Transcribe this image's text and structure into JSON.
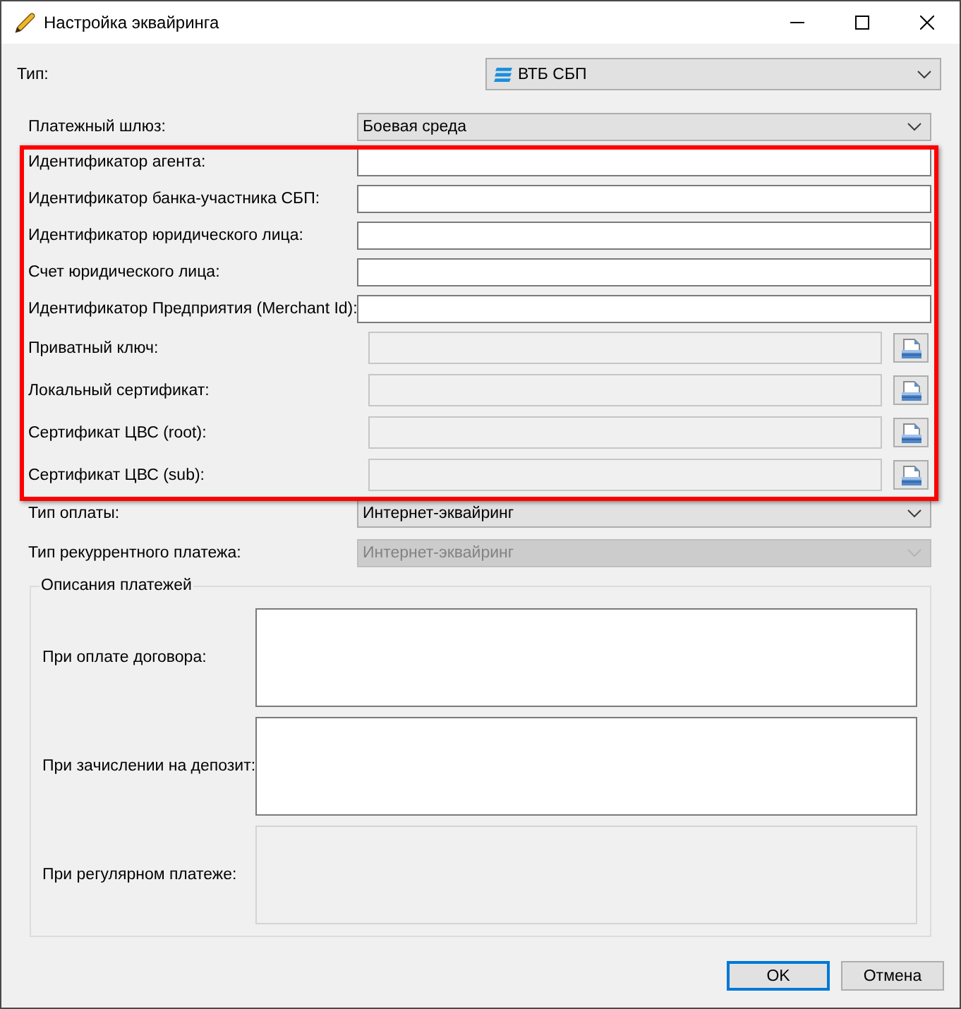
{
  "window": {
    "title": "Настройка эквайринга"
  },
  "type": {
    "label": "Тип:",
    "value": "ВТБ СБП",
    "disabled": false
  },
  "gateway": {
    "label": "Платежный шлюз:",
    "value": "Боевая среда",
    "disabled": false
  },
  "credentials": {
    "highlighted": true,
    "fields": [
      {
        "kind": "text",
        "label": "Идентификатор агента:",
        "disabled": false
      },
      {
        "kind": "text",
        "label": "Идентификатор банка-участника СБП:",
        "disabled": false
      },
      {
        "kind": "text",
        "label": "Идентификатор юридического лица:",
        "disabled": false
      },
      {
        "kind": "text",
        "label": "Счет юридического лица:",
        "disabled": false
      },
      {
        "kind": "text",
        "label": "Идентификатор Предприятия (Merchant Id):",
        "disabled": false
      },
      {
        "kind": "file",
        "label": "Приватный ключ:",
        "disabled": true
      },
      {
        "kind": "file",
        "label": "Локальный сертификат:",
        "disabled": true
      },
      {
        "kind": "file",
        "label": "Сертификат ЦВС (root):",
        "disabled": true
      },
      {
        "kind": "file",
        "label": "Сертификат ЦВС (sub):",
        "disabled": true
      }
    ]
  },
  "payment_type": {
    "label": "Тип оплаты:",
    "value": "Интернет-эквайринг",
    "disabled": false
  },
  "recurring_type": {
    "label": "Тип рекуррентного платежа:",
    "value": "Интернет-эквайринг",
    "disabled": true
  },
  "descriptions": {
    "title": "Описания платежей",
    "fields": [
      {
        "label": "При оплате договора:",
        "disabled": false
      },
      {
        "label": "При зачислении на депозит:",
        "disabled": false
      },
      {
        "label": "При регулярном платеже:",
        "disabled": true
      }
    ]
  },
  "buttons": [
    {
      "label": "OK",
      "default": true
    },
    {
      "label": "Отмена",
      "default": false
    }
  ]
}
